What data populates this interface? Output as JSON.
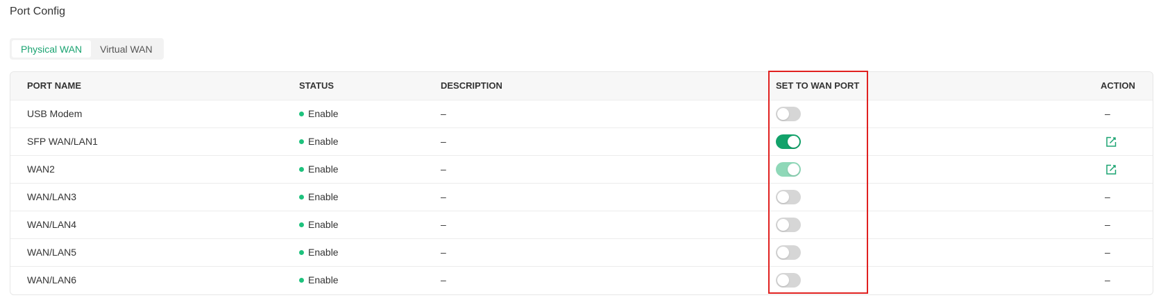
{
  "page": {
    "title": "Port Config"
  },
  "tabs": [
    {
      "label": "Physical WAN",
      "active": true
    },
    {
      "label": "Virtual WAN",
      "active": false
    }
  ],
  "table": {
    "columns": {
      "port_name": "PORT NAME",
      "status": "STATUS",
      "description": "DESCRIPTION",
      "set_to_wan": "SET TO WAN PORT",
      "action": "ACTION"
    },
    "rows": [
      {
        "port_name": "USB Modem",
        "status": "Enable",
        "description": "–",
        "set_to_wan": "off",
        "action": "–"
      },
      {
        "port_name": "SFP WAN/LAN1",
        "status": "Enable",
        "description": "–",
        "set_to_wan": "on",
        "action": "edit-icon"
      },
      {
        "port_name": "WAN2",
        "status": "Enable",
        "description": "–",
        "set_to_wan": "on-disabled",
        "action": "edit-icon"
      },
      {
        "port_name": "WAN/LAN3",
        "status": "Enable",
        "description": "–",
        "set_to_wan": "off",
        "action": "–"
      },
      {
        "port_name": "WAN/LAN4",
        "status": "Enable",
        "description": "–",
        "set_to_wan": "off",
        "action": "–"
      },
      {
        "port_name": "WAN/LAN5",
        "status": "Enable",
        "description": "–",
        "set_to_wan": "off",
        "action": "–"
      },
      {
        "port_name": "WAN/LAN6",
        "status": "Enable",
        "description": "–",
        "set_to_wan": "off",
        "action": "–"
      }
    ]
  },
  "colors": {
    "accent": "#1aa371",
    "status_dot": "#1ec27d",
    "toggle_on": "#12a26a",
    "toggle_on_disabled": "#8fd8b8",
    "toggle_off": "#d6d6d6",
    "highlight_border": "#e0201f"
  }
}
